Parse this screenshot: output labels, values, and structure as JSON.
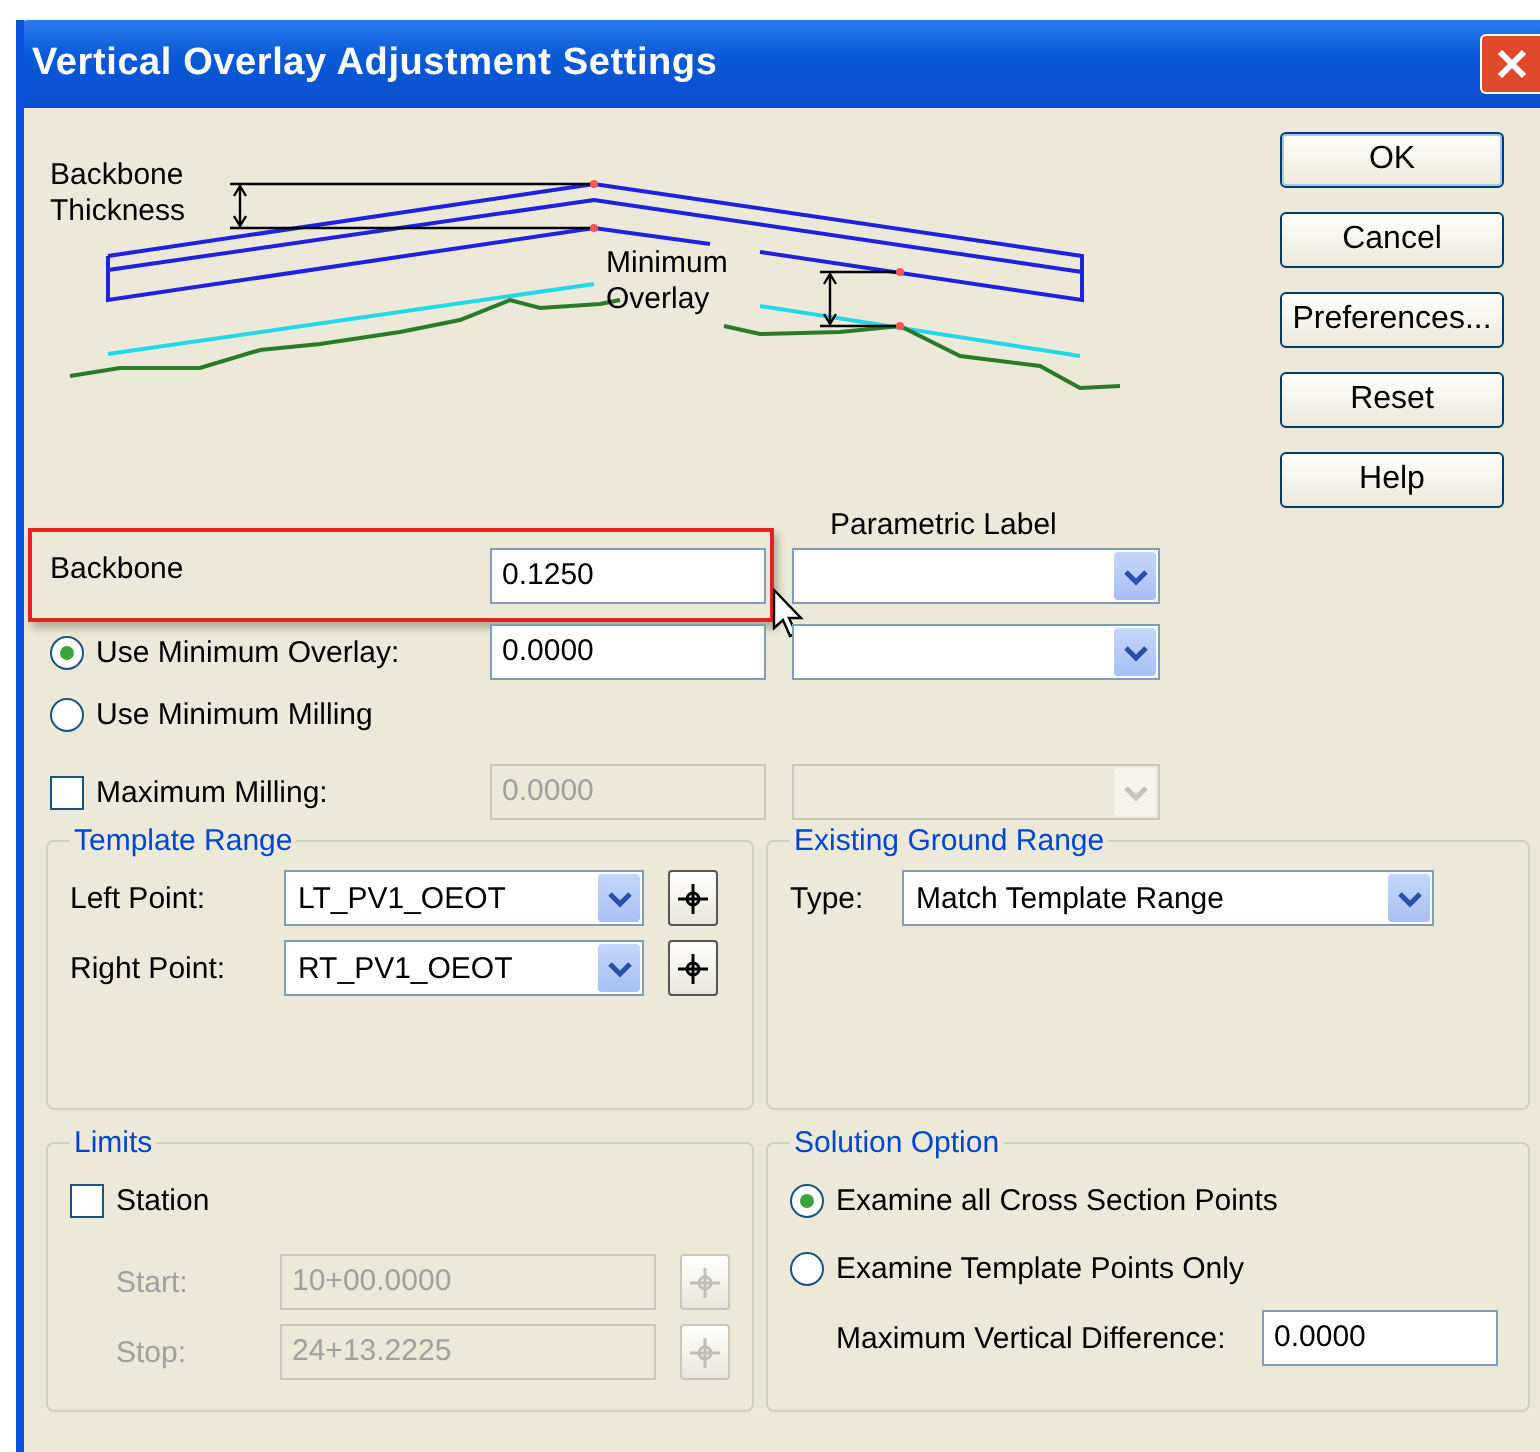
{
  "window": {
    "title": "Vertical Overlay Adjustment Settings"
  },
  "diagram": {
    "thickness_label": [
      "Backbone",
      "Thickness"
    ],
    "overlay_label": [
      "Minimum",
      "Overlay"
    ]
  },
  "buttons": [
    "OK",
    "Cancel",
    "Preferences...",
    "Reset",
    "Help"
  ],
  "parametric_label_header": "Parametric Label",
  "rows": [
    {
      "kind": "label",
      "label": "Backbone",
      "value": "0.1250",
      "highlighted": true
    },
    {
      "kind": "radio",
      "label": "Use Minimum Overlay:",
      "selected": true,
      "value": "0.0000"
    },
    {
      "kind": "radio",
      "label": "Use Minimum Milling",
      "selected": false
    },
    {
      "kind": "checkbox",
      "label": "Maximum Milling:",
      "checked": false,
      "value": "0.0000",
      "disabled": true
    }
  ],
  "template_range": {
    "title": "Template Range",
    "points": [
      {
        "label": "Left Point:",
        "value": "LT_PV1_OEOT"
      },
      {
        "label": "Right Point:",
        "value": "RT_PV1_OEOT"
      }
    ]
  },
  "existing_ground_range": {
    "title": "Existing Ground Range",
    "type_label": "Type:",
    "type_value": "Match Template Range"
  },
  "limits": {
    "title": "Limits",
    "station": {
      "label": "Station",
      "checked": false
    },
    "fields": [
      {
        "label": "Start:",
        "value": "10+00.0000",
        "disabled": true
      },
      {
        "label": "Stop:",
        "value": "24+13.2225",
        "disabled": true
      }
    ]
  },
  "solution_option": {
    "title": "Solution Option",
    "options": [
      {
        "label": "Examine all Cross Section Points",
        "selected": true
      },
      {
        "label": "Examine Template Points Only",
        "selected": false
      }
    ],
    "max_diff_label": "Maximum Vertical Difference:",
    "max_diff_value": "0.0000"
  }
}
